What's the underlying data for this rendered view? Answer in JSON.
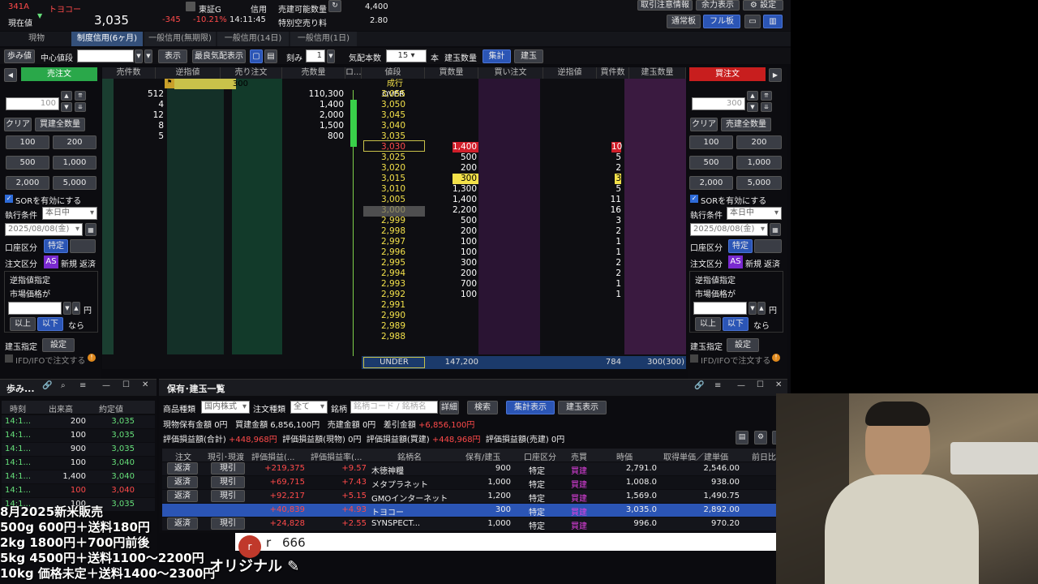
{
  "header": {
    "code": "341A",
    "name": "トヨコー",
    "cur_label": "現在値",
    "price": "3,035",
    "change": "-345",
    "change_pct": "-10.21%",
    "time": "14:11:45",
    "exchange": "東証G",
    "credit": "信用",
    "sell_avail_label": "売建可能数量",
    "sell_avail": "4,400",
    "special_label": "特別空売り料",
    "special": "2.80",
    "btn_notice": "取引注意情報",
    "btn_yobo": "余力表示",
    "btn_settings": "設定",
    "btn_normal": "通常板",
    "btn_full": "フル板"
  },
  "tabs": [
    "現物",
    "制度信用(6ヶ月)",
    "一般信用(無期限)",
    "一般信用(14日)",
    "一般信用(1日)"
  ],
  "toolbar": {
    "ayumi": "歩み値",
    "center_label": "中心値段",
    "display": "表示",
    "best": "最良気配表示",
    "kizami": "刻み",
    "kizami_val": "1",
    "kehai_label": "気配本数",
    "kehai_val": "15",
    "hon": "本",
    "tate_label": "建玉数量",
    "shukei": "集計",
    "tatedama": "建玉"
  },
  "left_order": {
    "title": "売注文",
    "qty": "100",
    "clear": "クリア",
    "all_qty": "買建全数量",
    "q": [
      "100",
      "200",
      "500",
      "1,000",
      "2,000",
      "5,000"
    ],
    "sor": "SORを有効にする",
    "exec_label": "執行条件",
    "exec_val": "本日中",
    "date": "2025/08/08(金)",
    "acct_label": "口座区分",
    "acct_val": "特定",
    "ord_label": "注文区分",
    "as": "AS",
    "new": "新規",
    "ret": "返済",
    "stop_label": "逆指値指定",
    "market_label": "市場価格が",
    "yen": "円",
    "above": "以上",
    "below": "以下",
    "nara": "なら",
    "tate_label": "建玉指定",
    "setting": "設定",
    "ifd": "IFD/IFOで注文する"
  },
  "right_order": {
    "title": "買注文",
    "qty": "300",
    "clear": "クリア",
    "all_qty": "売建全数量",
    "q": [
      "100",
      "200",
      "500",
      "1,000",
      "2,000",
      "5,000"
    ],
    "sor": "SORを有効にする",
    "exec_label": "執行条件",
    "exec_val": "本日中",
    "date": "2025/08/08(金)",
    "acct_label": "口座区分",
    "acct_val": "特定",
    "ord_label": "注文区分",
    "as": "AS",
    "new": "新規",
    "ret": "返済",
    "stop_label": "逆指値指定",
    "market_label": "市場価格が",
    "yen": "円",
    "above": "以上",
    "below": "以下",
    "nara": "なら",
    "tate_label": "建玉指定",
    "setting": "設定",
    "ifd": "IFD/IFOで注文する"
  },
  "book": {
    "cols": [
      "売件数",
      "逆指値",
      "売り注文",
      "売数量",
      "ロ...",
      "値段",
      "買数量",
      "買い注文",
      "逆指値",
      "買件数",
      "建玉数量"
    ],
    "gyakusashi_sell": "300",
    "market": "成行",
    "over": "OVER",
    "under": "UNDER",
    "under_buy": "147,200",
    "under_count": "784",
    "under_tate": "300(300)",
    "rows": [
      {
        "sc": "512",
        "sq": "110,300",
        "p": "3,055",
        "bq": "",
        "bc": ""
      },
      {
        "sc": "4",
        "sq": "1,400",
        "p": "3,050",
        "bq": "",
        "bc": ""
      },
      {
        "sc": "12",
        "sq": "2,000",
        "p": "3,045",
        "bq": "",
        "bc": ""
      },
      {
        "sc": "8",
        "sq": "1,500",
        "p": "3,040",
        "bq": "",
        "bc": ""
      },
      {
        "sc": "5",
        "sq": "800",
        "p": "3,035",
        "bq": "",
        "bc": ""
      },
      {
        "sc": "",
        "sq": "",
        "p": "3,030",
        "bq": "1,400",
        "bc": "10"
      },
      {
        "sc": "",
        "sq": "",
        "p": "3,025",
        "bq": "500",
        "bc": "5"
      },
      {
        "sc": "",
        "sq": "",
        "p": "3,020",
        "bq": "200",
        "bc": "2"
      },
      {
        "sc": "",
        "sq": "",
        "p": "3,015",
        "bq": "300",
        "bc": "3"
      },
      {
        "sc": "",
        "sq": "",
        "p": "3,010",
        "bq": "1,300",
        "bc": "5"
      },
      {
        "sc": "",
        "sq": "",
        "p": "3,005",
        "bq": "1,400",
        "bc": "11"
      },
      {
        "sc": "",
        "sq": "",
        "p": "3,000",
        "bq": "2,200",
        "bc": "16"
      },
      {
        "sc": "",
        "sq": "",
        "p": "2,999",
        "bq": "500",
        "bc": "3"
      },
      {
        "sc": "",
        "sq": "",
        "p": "2,998",
        "bq": "200",
        "bc": "2"
      },
      {
        "sc": "",
        "sq": "",
        "p": "2,997",
        "bq": "100",
        "bc": "1"
      },
      {
        "sc": "",
        "sq": "",
        "p": "2,996",
        "bq": "100",
        "bc": "1"
      },
      {
        "sc": "",
        "sq": "",
        "p": "2,995",
        "bq": "300",
        "bc": "2"
      },
      {
        "sc": "",
        "sq": "",
        "p": "2,994",
        "bq": "200",
        "bc": "2"
      },
      {
        "sc": "",
        "sq": "",
        "p": "2,993",
        "bq": "700",
        "bc": "1"
      },
      {
        "sc": "",
        "sq": "",
        "p": "2,992",
        "bq": "100",
        "bc": "1"
      },
      {
        "sc": "",
        "sq": "",
        "p": "2,991",
        "bq": "",
        "bc": ""
      },
      {
        "sc": "",
        "sq": "",
        "p": "2,990",
        "bq": "",
        "bc": ""
      },
      {
        "sc": "",
        "sq": "",
        "p": "2,989",
        "bq": "",
        "bc": ""
      },
      {
        "sc": "",
        "sq": "",
        "p": "2,988",
        "bq": "",
        "bc": ""
      }
    ]
  },
  "ayumi": {
    "title": "歩み...",
    "cols": [
      "時刻",
      "出来高",
      "約定値"
    ],
    "rows": [
      {
        "t": "14:1...",
        "v": "200",
        "p": "3,035",
        "c": "green"
      },
      {
        "t": "14:1...",
        "v": "100",
        "p": "3,035",
        "c": "green"
      },
      {
        "t": "14:1...",
        "v": "900",
        "p": "3,035",
        "c": "green"
      },
      {
        "t": "14:1...",
        "v": "100",
        "p": "3,040",
        "c": "green"
      },
      {
        "t": "14:1...",
        "v": "1,400",
        "p": "3,040",
        "c": "green"
      },
      {
        "t": "14:1...",
        "v": "100",
        "p": "3,040",
        "c": "red"
      },
      {
        "t": "14:1...",
        "v": "100",
        "p": "3,035",
        "c": "green"
      }
    ]
  },
  "holdings": {
    "title": "保有･建玉一覧",
    "prod_label": "商品種類",
    "prod_val": "国内株式",
    "ord_type_label": "注文種類",
    "ord_type_val": "全て",
    "meigara_label": "銘柄",
    "meigara_ph": "銘柄コード / 銘柄名",
    "detail": "詳細",
    "search": "検索",
    "shukei": "集計表示",
    "tate": "建玉表示",
    "s1": "現物保有金額",
    "s1v": "0円",
    "s2": "買建金額",
    "s2v": "6,856,100円",
    "s3": "売建金額",
    "s3v": "0円",
    "s4": "差引金額",
    "s4v": "+6,856,100円",
    "s5": "評価損益額(合計)",
    "s5v": "+448,968円",
    "s6": "評価損益額(現物)",
    "s6v": "0円",
    "s7": "評価損益額(買建)",
    "s7v": "+448,968円",
    "s8": "評価損益額(売建)",
    "s8v": "0円",
    "cols": [
      "注文",
      "現引･現渡",
      "評価損益(...",
      "評価損益率(...",
      "銘柄名",
      "保有/建玉",
      "口座区分",
      "売買",
      "時価",
      "取得単価／建単価",
      "前日比"
    ],
    "rows": [
      {
        "a": "返済",
        "b": "現引",
        "pl": "+219,375",
        "pr": "+9.57",
        "n": "木徳神糧",
        "q": "900",
        "acc": "特定",
        "side": "買建",
        "px": "2,791.0",
        "cost": "2,546.00",
        "sel": false
      },
      {
        "a": "返済",
        "b": "現引",
        "pl": "+69,715",
        "pr": "+7.43",
        "n": "メタプラネット",
        "q": "1,000",
        "acc": "特定",
        "side": "買建",
        "px": "1,008.0",
        "cost": "938.00",
        "sel": false
      },
      {
        "a": "返済",
        "b": "現引",
        "pl": "+92,217",
        "pr": "+5.15",
        "n": "GMOインターネット",
        "q": "1,200",
        "acc": "特定",
        "side": "買建",
        "px": "1,569.0",
        "cost": "1,490.75",
        "sel": false
      },
      {
        "a": "",
        "b": "",
        "pl": "+40,839",
        "pr": "+4.93",
        "n": "トヨコー",
        "q": "300",
        "acc": "特定",
        "side": "買建",
        "px": "3,035.0",
        "cost": "2,892.00",
        "sel": true
      },
      {
        "a": "返済",
        "b": "現引",
        "pl": "+24,828",
        "pr": "+2.55",
        "n": "SYNSPECT...",
        "q": "1,000",
        "acc": "特定",
        "side": "買建",
        "px": "996.0",
        "cost": "970.20",
        "sel": false
      }
    ]
  },
  "overlay": {
    "line1": "8月2025新米販売",
    "line2": "500g  600円＋送料180円",
    "line3": "2kg  1800円＋700円前後",
    "line4": "5kg  4500円＋送料1100〜2200円",
    "line5": "10kg  価格未定＋送料1400〜2300円",
    "comment_user": "r",
    "comment_text": "666",
    "original": "オリジナル"
  }
}
